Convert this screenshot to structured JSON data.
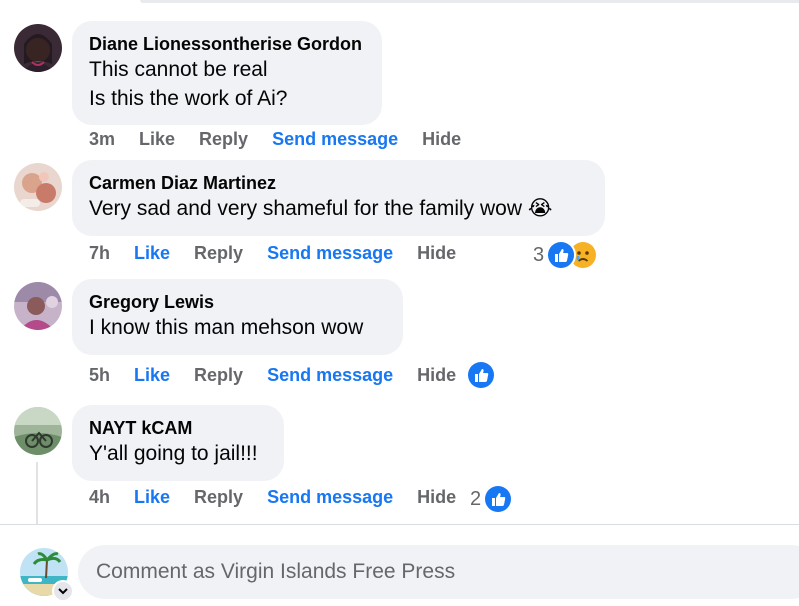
{
  "comments": [
    {
      "author": "Diane Lionessontherise Gordon",
      "lines": [
        "This cannot be real",
        "Is this the work of Ai?"
      ],
      "time": "3m",
      "like": "Like",
      "like_active": false,
      "reply": "Reply",
      "send": "Send message",
      "hide": "Hide",
      "reaction_count": "",
      "reactions": []
    },
    {
      "author": "Carmen Diaz Martinez",
      "lines": [
        "Very sad and very shameful for the family wow 😭"
      ],
      "time": "7h",
      "like": "Like",
      "like_active": true,
      "reply": "Reply",
      "send": "Send message",
      "hide": "Hide",
      "reaction_count": "3",
      "reactions": [
        "like-icon",
        "sad-face-icon"
      ]
    },
    {
      "author": "Gregory Lewis",
      "lines": [
        "I know this man mehson wow"
      ],
      "time": "5h",
      "like": "Like",
      "like_active": true,
      "reply": "Reply",
      "send": "Send message",
      "hide": "Hide",
      "reaction_count": "",
      "reactions": [
        "like-icon"
      ]
    },
    {
      "author": "NAYT kCAM",
      "lines": [
        "Y'all going to jail!!!"
      ],
      "time": "4h",
      "like": "Like",
      "like_active": true,
      "reply": "Reply",
      "send": "Send message",
      "hide": "Hide",
      "reaction_count": "2",
      "reactions": [
        "like-icon"
      ]
    }
  ],
  "composer": {
    "placeholder": "Comment as Virgin Islands Free Press"
  },
  "colors": {
    "accent": "#1877f2",
    "muted": "#65676b",
    "bubble": "#f0f2f5"
  }
}
